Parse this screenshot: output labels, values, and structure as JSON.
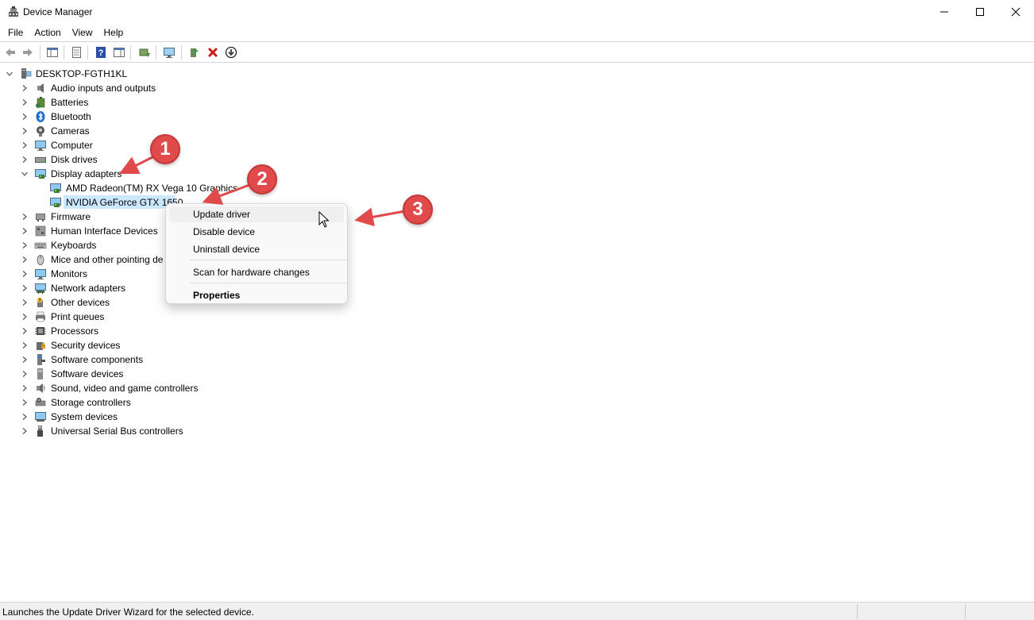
{
  "window": {
    "title": "Device Manager"
  },
  "menu": [
    "File",
    "Action",
    "View",
    "Help"
  ],
  "toolbar_icons": [
    "back-arrow-icon",
    "forward-arrow-icon",
    "show-hide-console-tree-icon",
    "properties-icon",
    "help-icon",
    "action-pane-icon",
    "update-driver-icon",
    "monitor-icon",
    "enable-device-icon",
    "uninstall-icon",
    "download-icon"
  ],
  "tree": {
    "root": "DESKTOP-FGTH1KL",
    "categories": [
      {
        "label": "Audio inputs and outputs",
        "icon": "audio-icon"
      },
      {
        "label": "Batteries",
        "icon": "battery-icon"
      },
      {
        "label": "Bluetooth",
        "icon": "bluetooth-icon"
      },
      {
        "label": "Cameras",
        "icon": "camera-icon"
      },
      {
        "label": "Computer",
        "icon": "computer-icon"
      },
      {
        "label": "Disk drives",
        "icon": "disk-drive-icon"
      },
      {
        "label": "Display adapters",
        "icon": "display-adapter-icon"
      },
      {
        "label": "Firmware",
        "icon": "firmware-icon"
      },
      {
        "label": "Human Interface Devices",
        "icon": "hid-icon"
      },
      {
        "label": "Keyboards",
        "icon": "keyboard-icon"
      },
      {
        "label": "Mice and other pointing de",
        "icon": "mouse-icon"
      },
      {
        "label": "Monitors",
        "icon": "monitor-icon"
      },
      {
        "label": "Network adapters",
        "icon": "network-adapter-icon"
      },
      {
        "label": "Other devices",
        "icon": "other-devices-icon"
      },
      {
        "label": "Print queues",
        "icon": "printer-icon"
      },
      {
        "label": "Processors",
        "icon": "processor-icon"
      },
      {
        "label": "Security devices",
        "icon": "security-icon"
      },
      {
        "label": "Software components",
        "icon": "software-component-icon"
      },
      {
        "label": "Software devices",
        "icon": "software-device-icon"
      },
      {
        "label": "Sound, video and game controllers",
        "icon": "sound-icon"
      },
      {
        "label": "Storage controllers",
        "icon": "storage-icon"
      },
      {
        "label": "System devices",
        "icon": "system-device-icon"
      },
      {
        "label": "Universal Serial Bus controllers",
        "icon": "usb-icon"
      }
    ],
    "display_children": [
      "AMD Radeon(TM) RX Vega 10 Graphics",
      "NVIDIA GeForce GTX 1650"
    ]
  },
  "context_menu": {
    "items": [
      "Update driver",
      "Disable device",
      "Uninstall device",
      "Scan for hardware changes",
      "Properties"
    ]
  },
  "annotations": [
    "1",
    "2",
    "3"
  ],
  "status": {
    "text": "Launches the Update Driver Wizard for the selected device."
  },
  "colors": {
    "selection": "#cce8ff",
    "annotation": "#e04a4a"
  }
}
